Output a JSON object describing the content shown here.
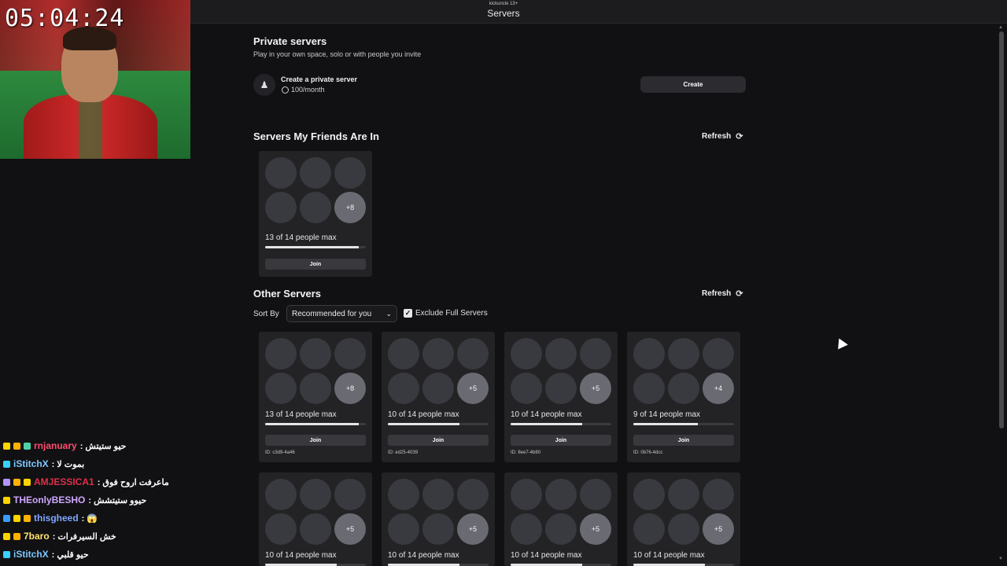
{
  "topbar": {
    "subtitle": "kickuncle 13+",
    "title": "Servers"
  },
  "stream": {
    "timer": "05:04:24"
  },
  "private": {
    "title": "Private servers",
    "subtitle": "Play in your own space, solo or with people you invite",
    "create_label": "Create a private server",
    "price": "100/month",
    "create_button": "Create"
  },
  "friends": {
    "title": "Servers My Friends Are In",
    "refresh": "Refresh",
    "server": {
      "more": "+8",
      "capacity": "13 of 14 people max",
      "fill": 0.93,
      "join": "Join"
    }
  },
  "other": {
    "title": "Other Servers",
    "refresh": "Refresh",
    "sort_label": "Sort By",
    "sort_value": "Recommended for you",
    "exclude_label": "Exclude Full Servers",
    "exclude_checked": true,
    "servers": [
      {
        "more": "+8",
        "capacity": "13 of 14 people max",
        "fill": 0.93,
        "join": "Join",
        "id": "ID: c3d9-4a46"
      },
      {
        "more": "+5",
        "capacity": "10 of 14 people max",
        "fill": 0.71,
        "join": "Join",
        "id": "ID: ed25-4039"
      },
      {
        "more": "+5",
        "capacity": "10 of 14 people max",
        "fill": 0.71,
        "join": "Join",
        "id": "ID: 8ee7-4b80"
      },
      {
        "more": "+4",
        "capacity": "9 of 14 people max",
        "fill": 0.64,
        "join": "Join",
        "id": "ID: 0b76-4dcc"
      },
      {
        "more": "+5",
        "capacity": "10 of 14 people max",
        "fill": 0.71
      },
      {
        "more": "+5",
        "capacity": "10 of 14 people max",
        "fill": 0.71
      },
      {
        "more": "+5",
        "capacity": "10 of 14 people max",
        "fill": 0.71
      },
      {
        "more": "+5",
        "capacity": "10 of 14 people max",
        "fill": 0.71
      }
    ]
  },
  "chat": [
    {
      "user": "rnjanuary",
      "color": "#ff4d6d",
      "msg": ": حيو ستيتش"
    },
    {
      "user": "iStitchX",
      "color": "#7ec8ff",
      "msg": ": بموت لا"
    },
    {
      "user": "AMJESSICA1",
      "color": "#e0304a",
      "msg": ": ماعرفت اروح فوق"
    },
    {
      "user": "THEonlyBESHO",
      "color": "#cfa8ff",
      "msg": ": حيوو ستيتشش"
    },
    {
      "user": "thisgheed",
      "color": "#7fa6ff",
      "msg": ": 😱"
    },
    {
      "user": "7baro",
      "color": "#ffe36e",
      "msg": ": خش السيرفرات"
    },
    {
      "user": "iStitchX",
      "color": "#7ec8ff",
      "msg": ": حيو قلبي"
    }
  ]
}
